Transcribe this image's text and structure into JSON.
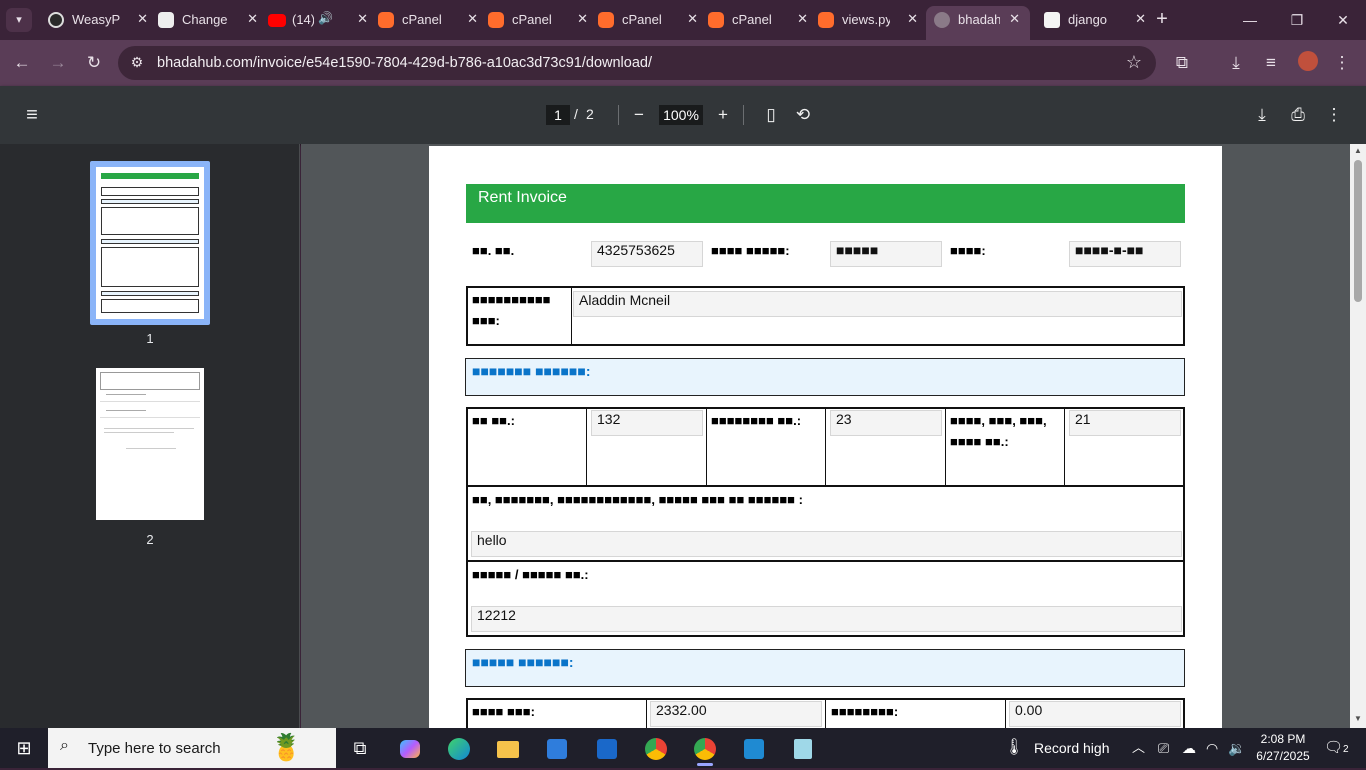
{
  "browser": {
    "tabs": [
      {
        "title": "WeasyPrint",
        "favicon": "weasyprint-icon"
      },
      {
        "title": "Change",
        "favicon": "admin-icon"
      },
      {
        "title": "(14)",
        "favicon": "youtube-icon",
        "audio": true
      },
      {
        "title": "cPanel",
        "favicon": "cpanel-icon"
      },
      {
        "title": "cPanel",
        "favicon": "cpanel-icon"
      },
      {
        "title": "cPanel",
        "favicon": "cpanel-icon"
      },
      {
        "title": "cPanel",
        "favicon": "cpanel-icon"
      },
      {
        "title": "views.py",
        "favicon": "cpanel-icon"
      },
      {
        "title": "bhadahub",
        "favicon": "globe-icon",
        "active": true
      },
      {
        "title": "django",
        "favicon": "django-icon"
      }
    ],
    "url": "bhadahub.com/invoice/e54e1590-7804-429d-b786-a10ac3d73c91/download/"
  },
  "pdf_toolbar": {
    "current_page": "1",
    "separator": "/",
    "total_pages": "2",
    "zoom": "100%"
  },
  "thumbnails": [
    {
      "label": "1",
      "selected": true
    },
    {
      "label": "2",
      "selected": false
    }
  ],
  "invoice": {
    "title": "Rent Invoice",
    "bill_no_label": "■■. ■■.",
    "bill_no_value": "4325753625",
    "date_np_label": "■■■■ ■■■■■:",
    "date_np_value": "■■■■■",
    "date_label": "■■■■:",
    "date_value": "■■■■-■-■■",
    "customer_label": "■■■■■■■■■■ ■■■:",
    "customer_value": "Aladdin Mcneil",
    "section_1": "■■■■■■■ ■■■■■■:",
    "ward_label": "■■ ■■.:",
    "ward_value": "132",
    "house_no_label": "■■■■■■■■ ■■.:",
    "house_no_value": "23",
    "road_label": "■■■■, ■■■, ■■■, ■■■■ ■■.:",
    "road_value": "21",
    "address_label": "■■, ■■■■■■■, ■■■■■■■■■■■■, ■■■■■ ■■■ ■■ ■■■■■■ :",
    "address_value": "hello",
    "plot_label": "■■■■■ / ■■■■■ ■■.:",
    "plot_value": "12212",
    "section_2": "■■■■■ ■■■■■■:",
    "rent_label": "■■■■ ■■■:",
    "rent_value": "2332.00",
    "discount_label": "■■■■■■■■:",
    "discount_value": "0.00"
  },
  "taskbar": {
    "search_placeholder": "Type here to search",
    "weather": "Record high",
    "time": "2:08 PM",
    "date": "6/27/2025",
    "notifications": "2"
  }
}
